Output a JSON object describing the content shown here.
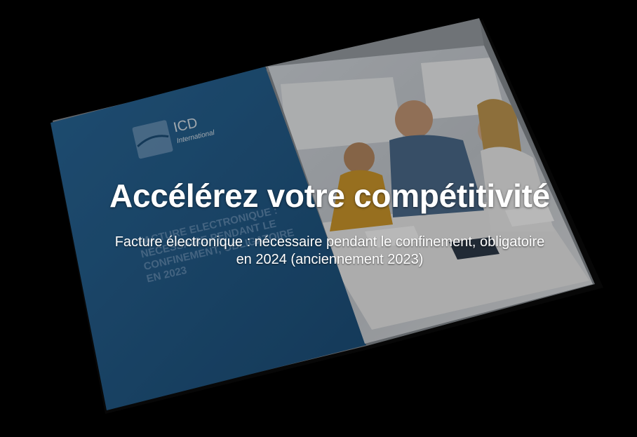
{
  "brochure": {
    "brand_name": "ICD",
    "brand_sub": "International",
    "cover_text_lines": [
      "FACTURE ELECTRONIQUE :",
      "NÉCESSAIRE PENDANT LE",
      "CONFINEMENT, OBLIGATOIRE",
      "EN 2023"
    ],
    "colors": {
      "panel_blue": "#24608f",
      "panel_blue_dark": "#184a72",
      "photo_light": "#cfd6de"
    }
  },
  "hero": {
    "title": "Accélérez votre compétitivité",
    "subtitle": "Facture électronique : nécessaire pendant le confinement, obligatoire en 2024 (anciennement 2023)"
  }
}
